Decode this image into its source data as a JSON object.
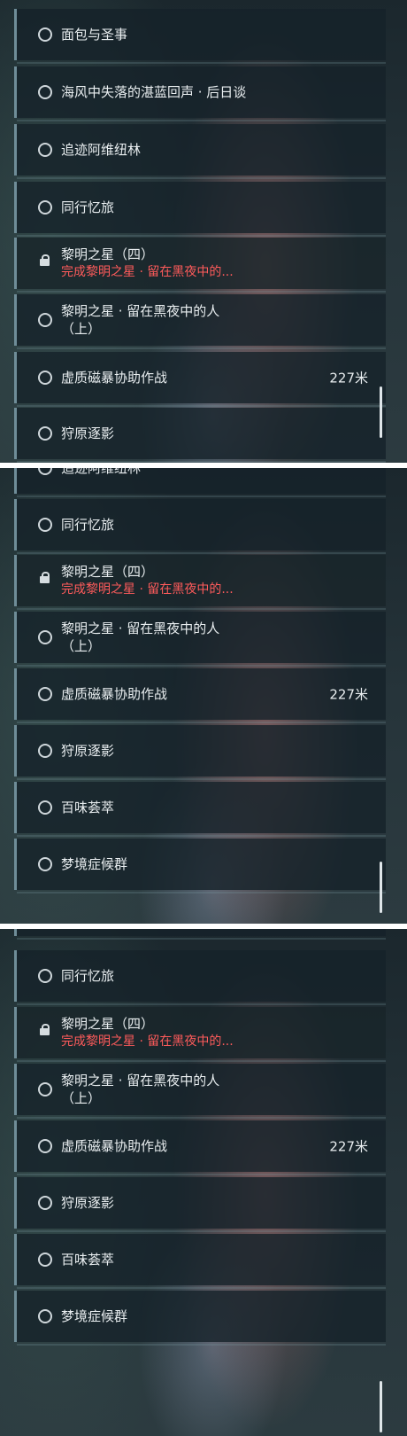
{
  "labels": {
    "bread_saint": "面包与圣事",
    "sea_wind": "海风中失落的湛蓝回声 · 后日谈",
    "trace_avi": "追迹阿维纽林",
    "together": "同行忆旅",
    "dawn4": "黎明之星（四）",
    "dawn4_req": "完成黎明之星 · 留在黑夜中的...",
    "dawn_stay_l1": "黎明之星 · 留在黑夜中的人",
    "dawn_stay_l2": "（上）",
    "void_storm": "虚质磁暴协助作战",
    "hunt_plain": "狩原逐影",
    "hundred_flavors": "百味荟萃",
    "dream_syndrome": "梦境症候群"
  },
  "distances": {
    "void_storm": "227米"
  },
  "icons": {
    "incomplete": "circle-icon",
    "locked": "lock-icon"
  },
  "colors": {
    "requirement_text": "#ff5b5b",
    "row_bg": "#152229",
    "accent_border": "#6f8d98"
  }
}
